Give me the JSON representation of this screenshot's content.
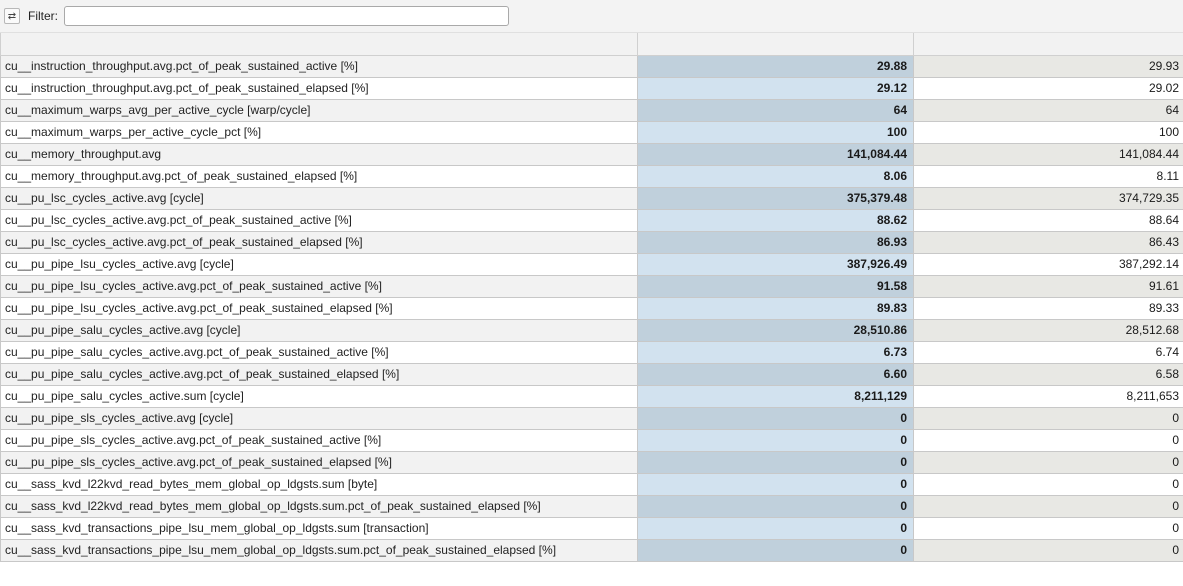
{
  "toolbar": {
    "toggle_icon": "swap-arrows-icon",
    "toggle_glyph": "⇄",
    "filter_label": "Filter:",
    "filter_value": ""
  },
  "table": {
    "rows": [
      {
        "name": "cu__instruction_throughput.avg.pct_of_peak_sustained_active [%]",
        "baseline": "29.88",
        "current": "29.93"
      },
      {
        "name": "cu__instruction_throughput.avg.pct_of_peak_sustained_elapsed [%]",
        "baseline": "29.12",
        "current": "29.02"
      },
      {
        "name": "cu__maximum_warps_avg_per_active_cycle [warp/cycle]",
        "baseline": "64",
        "current": "64"
      },
      {
        "name": "cu__maximum_warps_per_active_cycle_pct [%]",
        "baseline": "100",
        "current": "100"
      },
      {
        "name": "cu__memory_throughput.avg",
        "baseline": "141,084.44",
        "current": "141,084.44"
      },
      {
        "name": "cu__memory_throughput.avg.pct_of_peak_sustained_elapsed [%]",
        "baseline": "8.06",
        "current": "8.11"
      },
      {
        "name": "cu__pu_lsc_cycles_active.avg [cycle]",
        "baseline": "375,379.48",
        "current": "374,729.35"
      },
      {
        "name": "cu__pu_lsc_cycles_active.avg.pct_of_peak_sustained_active [%]",
        "baseline": "88.62",
        "current": "88.64"
      },
      {
        "name": "cu__pu_lsc_cycles_active.avg.pct_of_peak_sustained_elapsed [%]",
        "baseline": "86.93",
        "current": "86.43"
      },
      {
        "name": "cu__pu_pipe_lsu_cycles_active.avg [cycle]",
        "baseline": "387,926.49",
        "current": "387,292.14"
      },
      {
        "name": "cu__pu_pipe_lsu_cycles_active.avg.pct_of_peak_sustained_active [%]",
        "baseline": "91.58",
        "current": "91.61"
      },
      {
        "name": "cu__pu_pipe_lsu_cycles_active.avg.pct_of_peak_sustained_elapsed [%]",
        "baseline": "89.83",
        "current": "89.33"
      },
      {
        "name": "cu__pu_pipe_salu_cycles_active.avg [cycle]",
        "baseline": "28,510.86",
        "current": "28,512.68"
      },
      {
        "name": "cu__pu_pipe_salu_cycles_active.avg.pct_of_peak_sustained_active [%]",
        "baseline": "6.73",
        "current": "6.74"
      },
      {
        "name": "cu__pu_pipe_salu_cycles_active.avg.pct_of_peak_sustained_elapsed [%]",
        "baseline": "6.60",
        "current": "6.58"
      },
      {
        "name": "cu__pu_pipe_salu_cycles_active.sum [cycle]",
        "baseline": "8,211,129",
        "current": "8,211,653"
      },
      {
        "name": "cu__pu_pipe_sls_cycles_active.avg [cycle]",
        "baseline": "0",
        "current": "0"
      },
      {
        "name": "cu__pu_pipe_sls_cycles_active.avg.pct_of_peak_sustained_active [%]",
        "baseline": "0",
        "current": "0"
      },
      {
        "name": "cu__pu_pipe_sls_cycles_active.avg.pct_of_peak_sustained_elapsed [%]",
        "baseline": "0",
        "current": "0"
      },
      {
        "name": "cu__sass_kvd_l22kvd_read_bytes_mem_global_op_ldgsts.sum [byte]",
        "baseline": "0",
        "current": "0"
      },
      {
        "name": "cu__sass_kvd_l22kvd_read_bytes_mem_global_op_ldgsts.sum.pct_of_peak_sustained_elapsed [%]",
        "baseline": "0",
        "current": "0"
      },
      {
        "name": "cu__sass_kvd_transactions_pipe_lsu_mem_global_op_ldgsts.sum [transaction]",
        "baseline": "0",
        "current": "0"
      },
      {
        "name": "cu__sass_kvd_transactions_pipe_lsu_mem_global_op_ldgsts.sum.pct_of_peak_sustained_elapsed [%]",
        "baseline": "0",
        "current": "0"
      }
    ]
  }
}
